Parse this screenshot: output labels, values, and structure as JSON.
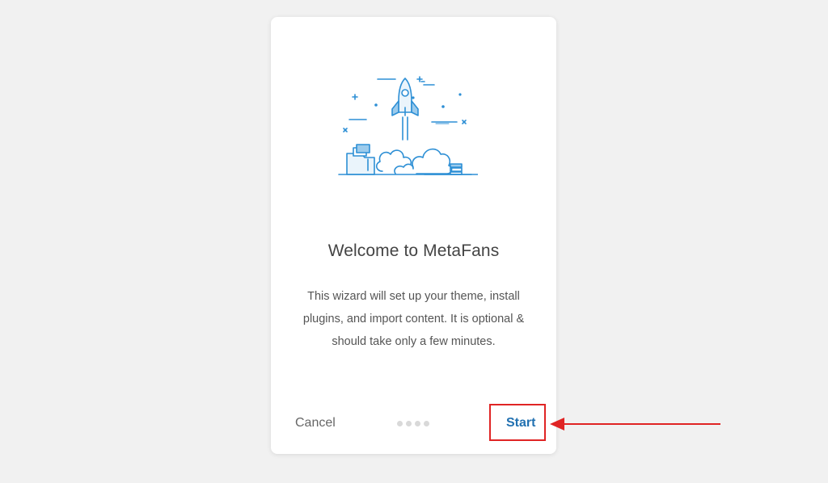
{
  "wizard": {
    "title": "Welcome to MetaFans",
    "description": "This wizard will set up your theme, install plugins, and import content. It is optional & should take only a few minutes.",
    "cancel_label": "Cancel",
    "start_label": "Start",
    "steps_total": 4,
    "current_step": 1,
    "illustration": "rocket-launch-icon"
  },
  "colors": {
    "accent": "#2271b1",
    "illustration_blue": "#2d8fd5",
    "annotation_red": "#e02424",
    "background": "#f1f1f1",
    "card": "#ffffff"
  },
  "annotation": {
    "type": "highlight-with-arrow",
    "target": "start-button"
  }
}
